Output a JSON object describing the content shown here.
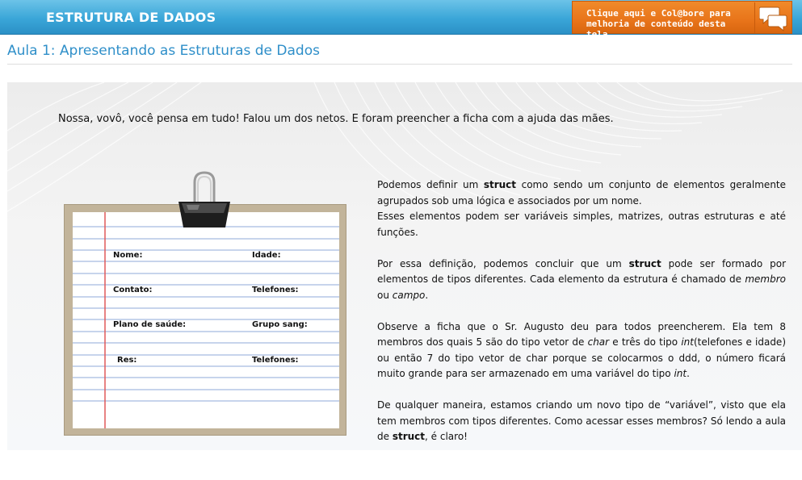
{
  "header": {
    "course_title": "ESTRUTURA DE DADOS",
    "collab_line1": "Clique aqui e Col@bore para",
    "collab_line2": "melhoria de conteúdo desta tela",
    "collab_icon": "chat-bubbles-icon",
    "bar_color": "#3aa6d8",
    "collab_color": "#e8741a"
  },
  "lesson": {
    "title": "Aula 1: Apresentando as Estruturas de Dados",
    "title_color": "#2f8fc9"
  },
  "content": {
    "intro": "Nossa, vovô, você pensa em tudo! Falou um dos netos.  E foram preencher a ficha com a ajuda das mães.",
    "form": {
      "nome": "Nome:",
      "idade": "Idade:",
      "contato": "Contato:",
      "telefones1": "Telefones:",
      "plano": "Plano de saúde:",
      "grupo": "Grupo sang:",
      "res": "Res:",
      "telefones2": "Telefones:"
    },
    "p1": {
      "a": "Podemos definir um ",
      "b": "struct",
      "c": " como sendo um conjunto de elementos geralmente agrupados sob uma lógica e associados por um nome.",
      "d": "Esses elementos podem ser variáveis simples, matrizes, outras estruturas e até funções."
    },
    "p2": {
      "a": "Por essa definição, podemos concluir que um ",
      "b": "struct",
      "c": " pode ser formado por elementos de tipos diferentes. Cada elemento da estrutura é chamado de ",
      "d": "membro",
      "e": " ou ",
      "f": "campo",
      "g": "."
    },
    "p3": {
      "a": "Observe a ficha que o Sr. Augusto deu para todos preencherem. Ela tem 8 membros dos quais 5 são do tipo vetor de ",
      "b": "char",
      "c": " e três do tipo ",
      "d": "int",
      "e": "(telefones e idade) ou então 7 do tipo vetor de char porque se colocarmos o ddd, o número ficará muito grande para ser armazenado em uma variável do tipo ",
      "f": "int",
      "g": "."
    },
    "p4": {
      "a": "De qualquer maneira, estamos criando um novo tipo de “variável”, visto que ela tem membros com tipos diferentes. Como acessar esses membros? Só lendo a aula de ",
      "b": "struct",
      "c": ", é claro!"
    }
  }
}
